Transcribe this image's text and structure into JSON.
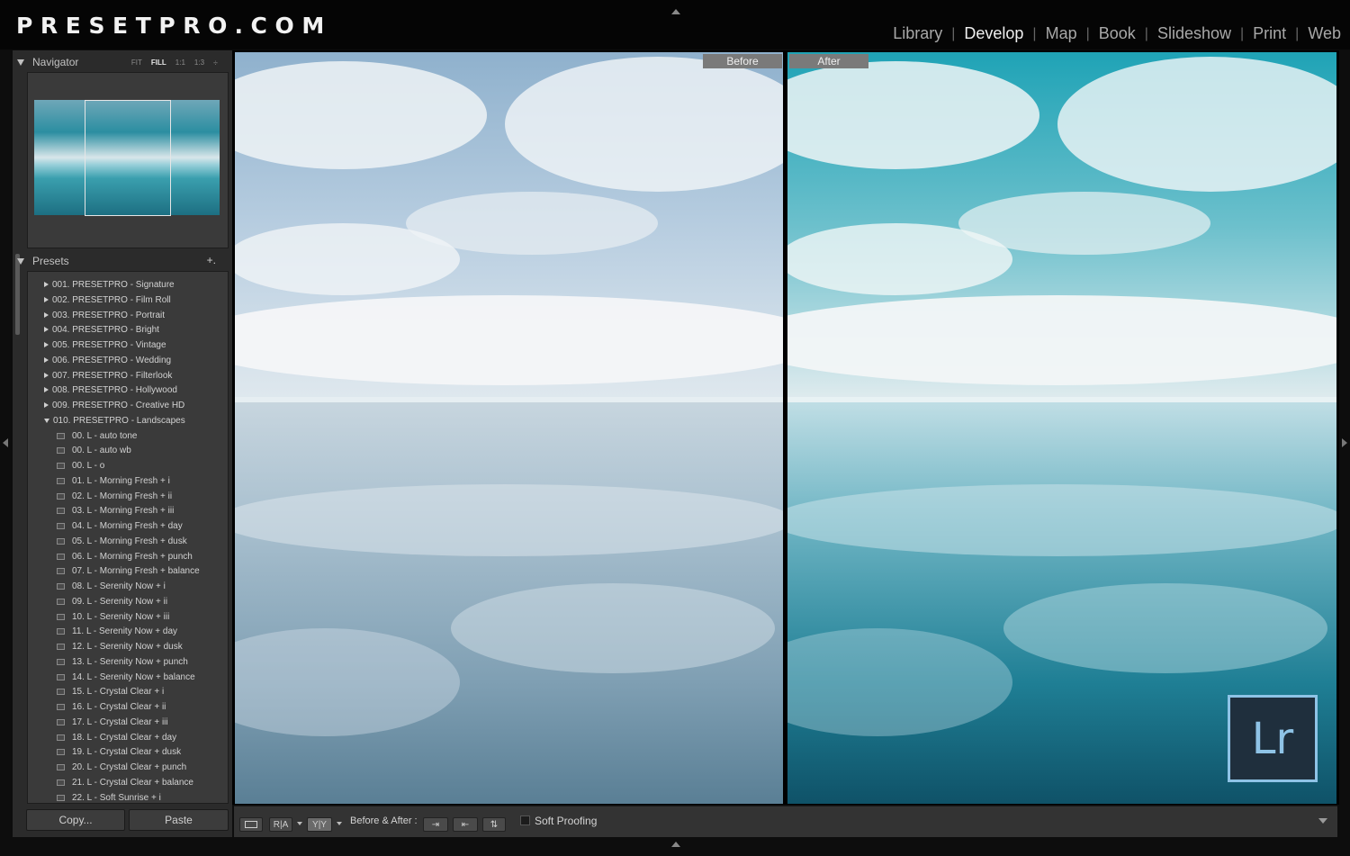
{
  "logo": "PRESETPRO.COM",
  "modules": [
    {
      "label": "Library",
      "active": false
    },
    {
      "label": "Develop",
      "active": true
    },
    {
      "label": "Map",
      "active": false
    },
    {
      "label": "Book",
      "active": false
    },
    {
      "label": "Slideshow",
      "active": false
    },
    {
      "label": "Print",
      "active": false
    },
    {
      "label": "Web",
      "active": false
    }
  ],
  "navigator": {
    "title": "Navigator",
    "zoom_options": [
      "FIT",
      "FILL",
      "1:1",
      "1:3"
    ],
    "active_zoom": "FILL"
  },
  "presets": {
    "title": "Presets",
    "add_symbol": "+.",
    "folders": [
      "001. PRESETPRO - Signature",
      "002. PRESETPRO - Film Roll",
      "003. PRESETPRO - Portrait",
      "004. PRESETPRO - Bright",
      "005. PRESETPRO - Vintage",
      "006. PRESETPRO - Wedding",
      "007. PRESETPRO - Filterlook",
      "008. PRESETPRO - Hollywood",
      "009. PRESETPRO - Creative HD"
    ],
    "open_folder": "010. PRESETPRO - Landscapes",
    "items": [
      "00. L - auto tone",
      "00. L - auto wb",
      "00. L - o",
      "01. L - Morning Fresh + i",
      "02. L - Morning Fresh + ii",
      "03. L - Morning Fresh + iii",
      "04. L - Morning Fresh + day",
      "05. L - Morning Fresh + dusk",
      "06. L - Morning Fresh + punch",
      "07. L - Morning Fresh + balance",
      "08. L - Serenity Now + i",
      "09. L - Serenity Now + ii",
      "10. L - Serenity Now + iii",
      "11. L - Serenity Now + day",
      "12. L - Serenity Now + dusk",
      "13. L - Serenity Now + punch",
      "14. L - Serenity Now + balance",
      "15. L - Crystal Clear + i",
      "16. L - Crystal Clear + ii",
      "17. L - Crystal Clear + iii",
      "18. L - Crystal Clear + day",
      "19. L - Crystal Clear + dusk",
      "20. L - Crystal Clear + punch",
      "21. L - Crystal Clear + balance",
      "22. L - Soft Sunrise + i"
    ]
  },
  "buttons": {
    "copy": "Copy...",
    "paste": "Paste"
  },
  "view": {
    "before_label": "Before",
    "after_label": "After"
  },
  "badge": {
    "text": "Lr"
  },
  "toolbar": {
    "before_after_label": "Before & After :",
    "soft_proofing": "Soft Proofing",
    "yy_label": "Y|Y",
    "ra_label": "R|A"
  },
  "colors": {
    "accent_badge": "#8ec3e6",
    "badge_bg": "#1f2f3d",
    "panel_bg": "#2b2b2b"
  }
}
